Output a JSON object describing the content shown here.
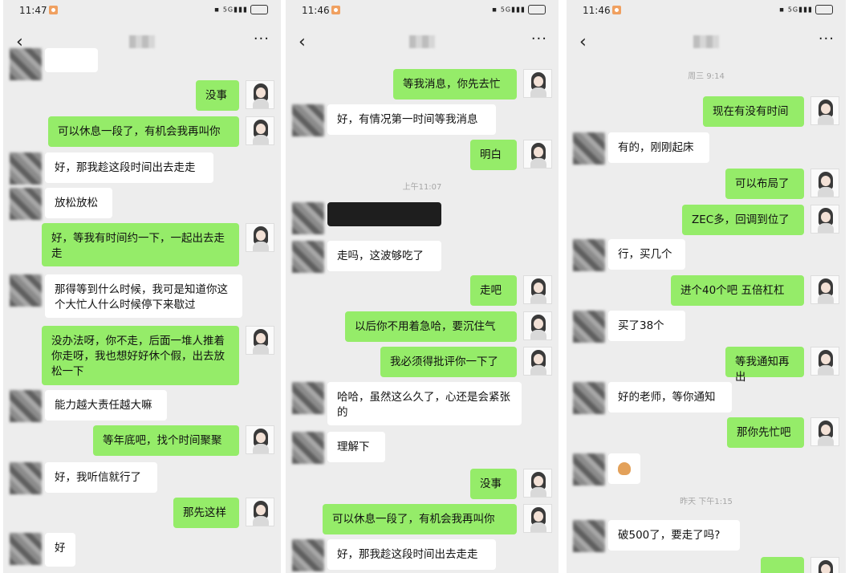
{
  "panels": [
    {
      "time": "11:47",
      "messages": [
        {
          "side": "other",
          "text": "",
          "fragment": true
        },
        {
          "side": "me",
          "text": "没事"
        },
        {
          "side": "me",
          "text": "可以休息一段了，有机会我再叫你"
        },
        {
          "side": "other",
          "text": "好，那我趁这段时间出去走走"
        },
        {
          "side": "other",
          "text": "放松放松"
        },
        {
          "side": "me",
          "text": "好，等我有时间约一下，一起出去走走"
        },
        {
          "side": "other",
          "text": "那得等到什么时候，我可是知道你这个大忙人什么时候停下来歇过"
        },
        {
          "side": "me",
          "text": "没办法呀，你不走，后面一堆人推着你走呀，我也想好好休个假，出去放松一下"
        },
        {
          "side": "other",
          "text": "能力越大责任越大嘛"
        },
        {
          "side": "me",
          "text": "等年底吧，找个时间聚聚"
        },
        {
          "side": "other",
          "text": "好，我听信就行了"
        },
        {
          "side": "me",
          "text": "那先这样"
        },
        {
          "side": "other",
          "text": "好"
        }
      ]
    },
    {
      "time": "11:46",
      "messages": [
        {
          "side": "me",
          "text": "等我消息，你先去忙"
        },
        {
          "side": "other",
          "text": "好，有情况第一时间等我消息"
        },
        {
          "side": "me",
          "text": "明白"
        },
        {
          "type": "timestamp",
          "text": "上午11:07"
        },
        {
          "side": "other",
          "text": "",
          "redacted": true
        },
        {
          "side": "other",
          "text": "走吗，这波够吃了"
        },
        {
          "side": "me",
          "text": "走吧"
        },
        {
          "side": "me",
          "text": "以后你不用着急哈，要沉住气"
        },
        {
          "side": "me",
          "text": "我必须得批评你一下了"
        },
        {
          "side": "other",
          "text": "哈哈，虽然这么久了，心还是会紧张的"
        },
        {
          "side": "other",
          "text": "理解下"
        },
        {
          "side": "me",
          "text": "没事"
        },
        {
          "side": "me",
          "text": "可以休息一段了，有机会我再叫你"
        },
        {
          "side": "other",
          "text": "好，那我趁这段时间出去走走"
        }
      ]
    },
    {
      "time": "11:46",
      "messages": [
        {
          "type": "timestamp",
          "text": "周三 9:14"
        },
        {
          "side": "me",
          "text": "现在有没有时间"
        },
        {
          "side": "other",
          "text": "有的，刚刚起床"
        },
        {
          "side": "me",
          "text": "可以布局了"
        },
        {
          "side": "me",
          "text": "ZEC多，回调到位了"
        },
        {
          "side": "other",
          "text": "行，买几个"
        },
        {
          "side": "me",
          "text": "进个40个吧 五倍杠杠"
        },
        {
          "side": "other",
          "text": "买了38个"
        },
        {
          "side": "me",
          "text": "等我通知再出"
        },
        {
          "side": "other",
          "text": "好的老师，等你通知"
        },
        {
          "side": "me",
          "text": "那你先忙吧"
        },
        {
          "side": "other",
          "text": "",
          "emoji": true
        },
        {
          "type": "timestamp",
          "text": "昨天 下午1:15"
        },
        {
          "side": "other",
          "text": "破500了，要走了吗?"
        },
        {
          "side": "me",
          "text": "",
          "fragment": true
        }
      ]
    }
  ],
  "colors": {
    "me_bubble": "#95ec69",
    "other_bubble": "#ffffff",
    "background": "#ededed"
  },
  "icons": [
    "back-arrow-icon",
    "more-icon",
    "signal-icon",
    "battery-icon",
    "notification-icon"
  ]
}
